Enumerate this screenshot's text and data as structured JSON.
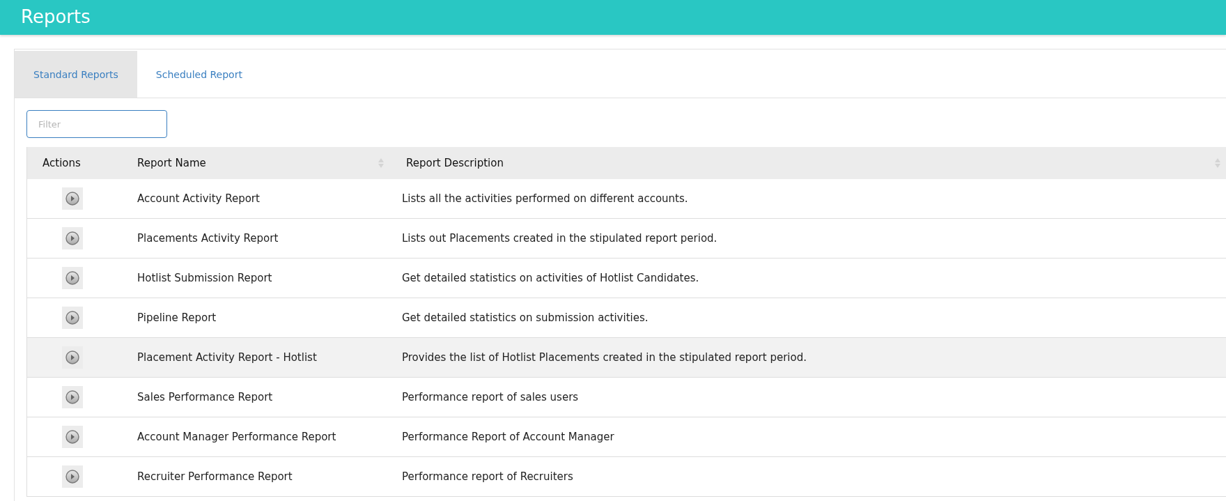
{
  "header": {
    "title": "Reports"
  },
  "tabs": [
    {
      "label": "Standard Reports",
      "selected": true
    },
    {
      "label": "Scheduled Report",
      "selected": false
    }
  ],
  "filter": {
    "placeholder": "Filter"
  },
  "table": {
    "columns": [
      {
        "label": "Actions",
        "sortable": false
      },
      {
        "label": "Report Name",
        "sortable": true
      },
      {
        "label": "Report Description",
        "sortable": true
      }
    ],
    "rows": [
      {
        "name": "Account Activity Report",
        "description": "Lists all the activities performed on different accounts.",
        "highlighted": false
      },
      {
        "name": "Placements Activity Report",
        "description": "Lists out Placements created in the stipulated report period.",
        "highlighted": false
      },
      {
        "name": "Hotlist Submission Report",
        "description": "Get detailed statistics on activities of Hotlist Candidates.",
        "highlighted": false
      },
      {
        "name": "Pipeline Report",
        "description": "Get detailed statistics on submission activities.",
        "highlighted": false
      },
      {
        "name": "Placement Activity Report - Hotlist",
        "description": "Provides the list of Hotlist Placements created in the stipulated report period.",
        "highlighted": true
      },
      {
        "name": "Sales Performance Report",
        "description": "Performance report of sales users",
        "highlighted": false
      },
      {
        "name": "Account Manager Performance Report",
        "description": "Performance Report of Account Manager",
        "highlighted": false
      },
      {
        "name": "Recruiter Performance Report",
        "description": "Performance report of Recruiters",
        "highlighted": false
      }
    ]
  }
}
